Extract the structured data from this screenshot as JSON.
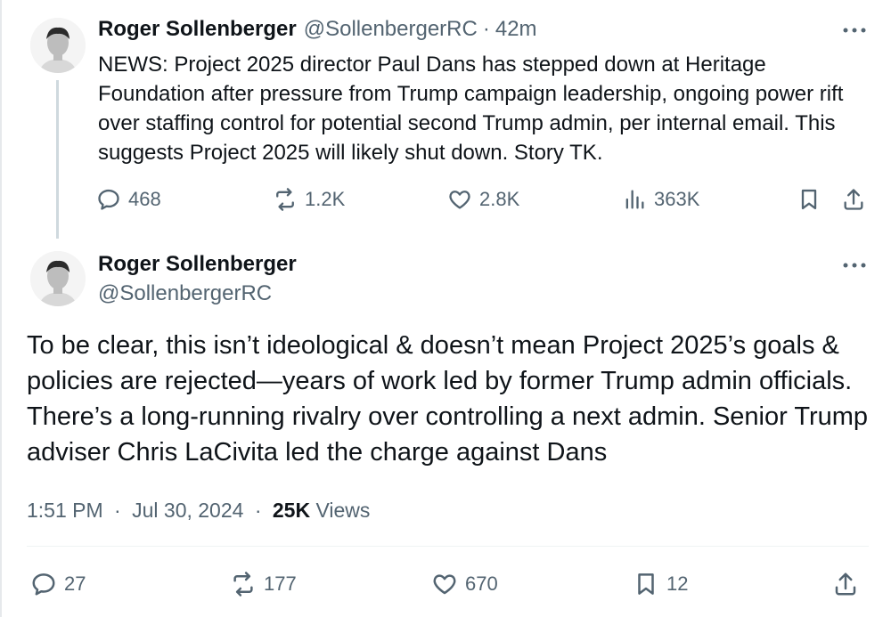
{
  "thread_tweet": {
    "author_name": "Roger Sollenberger",
    "handle": "@SollenbergerRC",
    "separator": "·",
    "time_ago": "42m",
    "text": "NEWS: Project 2025 director Paul Dans has stepped down at Heritage Foundation after pressure from Trump campaign leadership, ongoing power rift over staffing control for potential second Trump admin, per internal email. This suggests Project 2025 will likely shut down. Story TK.",
    "actions": {
      "replies": "468",
      "reposts": "1.2K",
      "likes": "2.8K",
      "views": "363K"
    }
  },
  "main_tweet": {
    "author_name": "Roger Sollenberger",
    "handle": "@SollenbergerRC",
    "text": "To be clear, this isn’t ideological & doesn’t mean Project 2025’s goals & policies are rejected—years of work led by former Trump admin officials. There’s a long-running rivalry over controlling a next admin. Senior Trump adviser Chris LaCivita led the charge against Dans",
    "time": "1:51 PM",
    "date": "Jul 30, 2024",
    "separator": "·",
    "views_count": "25K",
    "views_label": "Views",
    "actions": {
      "replies": "27",
      "reposts": "177",
      "likes": "670",
      "bookmarks": "12"
    }
  },
  "icons": {
    "reply": "reply-icon",
    "repost": "repost-icon",
    "like": "heart-icon",
    "views": "analytics-icon",
    "bookmark": "bookmark-icon",
    "share": "share-icon",
    "more": "more-icon"
  },
  "colors": {
    "text": "#0f1419",
    "muted": "#536471",
    "thread_line": "#cfd9de",
    "divider": "#eff3f4"
  }
}
